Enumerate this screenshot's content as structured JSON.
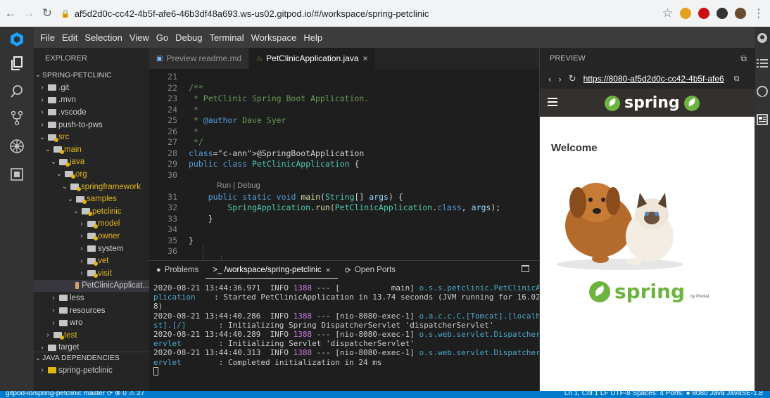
{
  "browser": {
    "url": "af5d2d0c-cc42-4b5f-afe6-46b3df48a693.ws-us02.gitpod.io/#/workspace/spring-petclinic",
    "ext_colors": [
      "#e5a11c",
      "#cc0f16",
      "#333333",
      "#6b4a2e"
    ]
  },
  "menu": [
    "File",
    "Edit",
    "Selection",
    "View",
    "Go",
    "Debug",
    "Terminal",
    "Workspace",
    "Help"
  ],
  "activity_icons": [
    "gitpod-logo-icon",
    "files-icon",
    "search-icon",
    "source-control-icon",
    "extensions-icon",
    "remote-explorer-icon"
  ],
  "right_rail_icons": [
    "github-icon",
    "outline-icon",
    "github-octocat-icon",
    "preview-icon"
  ],
  "explorer": {
    "title": "EXPLORER",
    "project": "SPRING-PETCLINIC",
    "tree": [
      {
        "label": ".git",
        "indent": 0,
        "chev": "›",
        "type": "folder"
      },
      {
        "label": ".mvn",
        "indent": 0,
        "chev": "›",
        "type": "folder"
      },
      {
        "label": ".vscode",
        "indent": 0,
        "chev": "›",
        "type": "folder"
      },
      {
        "label": "push-to-pws",
        "indent": 0,
        "chev": "›",
        "type": "folder"
      },
      {
        "label": "src",
        "indent": 0,
        "chev": "⌄",
        "type": "folder-mod"
      },
      {
        "label": "main",
        "indent": 1,
        "chev": "⌄",
        "type": "folder-mod"
      },
      {
        "label": "java",
        "indent": 2,
        "chev": "⌄",
        "type": "folder-mod"
      },
      {
        "label": "org",
        "indent": 3,
        "chev": "⌄",
        "type": "folder-mod"
      },
      {
        "label": "springframework",
        "indent": 4,
        "chev": "⌄",
        "type": "folder-mod"
      },
      {
        "label": "samples",
        "indent": 5,
        "chev": "⌄",
        "type": "folder-mod"
      },
      {
        "label": "petclinic",
        "indent": 6,
        "chev": "⌄",
        "type": "folder-mod"
      },
      {
        "label": "model",
        "indent": 7,
        "chev": "›",
        "type": "folder-mod"
      },
      {
        "label": "owner",
        "indent": 7,
        "chev": "›",
        "type": "folder-mod"
      },
      {
        "label": "system",
        "indent": 7,
        "chev": "›",
        "type": "folder"
      },
      {
        "label": "vet",
        "indent": 7,
        "chev": "›",
        "type": "folder-mod"
      },
      {
        "label": "visit",
        "indent": 7,
        "chev": "›",
        "type": "folder-mod"
      },
      {
        "label": "PetClinicApplicat...",
        "indent": 8,
        "chev": "",
        "type": "file",
        "selected": true
      },
      {
        "label": "less",
        "indent": 2,
        "chev": "›",
        "type": "folder"
      },
      {
        "label": "resources",
        "indent": 2,
        "chev": "›",
        "type": "folder"
      },
      {
        "label": "wro",
        "indent": 2,
        "chev": "›",
        "type": "folder"
      },
      {
        "label": "test",
        "indent": 1,
        "chev": "›",
        "type": "folder-mod"
      },
      {
        "label": "target",
        "indent": 0,
        "chev": "›",
        "type": "folder"
      }
    ],
    "java_deps": "JAVA DEPENDENCIES",
    "dep_item": "spring-petclinic"
  },
  "editor": {
    "tabs": [
      {
        "label": "Preview readme.md",
        "icon": "preview-icon",
        "active": false
      },
      {
        "label": "PetClinicApplication.java",
        "icon": "java-icon",
        "active": true
      }
    ],
    "code_lens": "Run | Debug",
    "lines": [
      {
        "n": "21",
        "text": ""
      },
      {
        "n": "22",
        "text": "/**"
      },
      {
        "n": "23",
        "text": " * PetClinic Spring Boot Application."
      },
      {
        "n": "24",
        "text": " *"
      },
      {
        "n": "25",
        "text": " * @author Dave Syer"
      },
      {
        "n": "26",
        "text": " *"
      },
      {
        "n": "27",
        "text": " */"
      },
      {
        "n": "28",
        "text": "@SpringBootApplication"
      },
      {
        "n": "29",
        "text": "public class PetClinicApplication {"
      },
      {
        "n": "30",
        "text": ""
      },
      {
        "n": "31",
        "text": "    public static void main(String[] args) {"
      },
      {
        "n": "32",
        "text": "        SpringApplication.run(PetClinicApplication.class, args);"
      },
      {
        "n": "33",
        "text": "    }"
      },
      {
        "n": "34",
        "text": ""
      },
      {
        "n": "35",
        "text": "}"
      },
      {
        "n": "36",
        "text": ""
      }
    ]
  },
  "panel": {
    "tabs": [
      "Problems",
      ">_ /workspace/spring-petclinic",
      "Open Ports"
    ],
    "terminal": [
      [
        [
          "2020-08-21 13:44:36.971  INFO ",
          "t-info"
        ],
        [
          "1388",
          "t-pid"
        ],
        [
          " --- [           main] ",
          "t-info"
        ],
        [
          "o.s.s.petclinic.PetClinicAp",
          "t-cls"
        ]
      ],
      [
        [
          "plication",
          "t-cls"
        ],
        [
          "    : Started PetClinicApplication in 13.74 seconds (JVM running for 16.02",
          "t-info"
        ]
      ],
      [
        [
          "8)",
          "t-info"
        ]
      ],
      [
        [
          "2020-08-21 13:44:40.286  INFO ",
          "t-info"
        ],
        [
          "1388",
          "t-pid"
        ],
        [
          " --- [nio-8080-exec-1] ",
          "t-info"
        ],
        [
          "o.a.c.c.C.[Tomcat].[localho",
          "t-cls"
        ]
      ],
      [
        [
          "st].[/]",
          "t-cls"
        ],
        [
          "       : Initializing Spring DispatcherServlet 'dispatcherServlet'",
          "t-info"
        ]
      ],
      [
        [
          "2020-08-21 13:44:40.289  INFO ",
          "t-info"
        ],
        [
          "1388",
          "t-pid"
        ],
        [
          " --- [nio-8080-exec-1] ",
          "t-info"
        ],
        [
          "o.s.web.servlet.DispatcherS",
          "t-cls"
        ]
      ],
      [
        [
          "ervlet",
          "t-cls"
        ],
        [
          "        : Initializing Servlet 'dispatcherServlet'",
          "t-info"
        ]
      ],
      [
        [
          "2020-08-21 13:44:40.313  INFO ",
          "t-info"
        ],
        [
          "1388",
          "t-pid"
        ],
        [
          " --- [nio-8080-exec-1] ",
          "t-info"
        ],
        [
          "o.s.web.servlet.DispatcherS",
          "t-cls"
        ]
      ],
      [
        [
          "ervlet",
          "t-cls"
        ],
        [
          "        : Completed initialization in 24 ms",
          "t-info"
        ]
      ]
    ]
  },
  "preview": {
    "title": "PREVIEW",
    "url": "https://8080-af5d2d0c-cc42-4b5f-afe6-...",
    "brand": "spring",
    "welcome": "Welcome",
    "footer_brand": "spring",
    "footer_by": "by Pivotal."
  },
  "status": {
    "left": "gitpod-io/spring-petclinic   master   ⟳   ⊗ 0 ⚠ 27",
    "right": "Ln 1, Col 1   LF   UTF-8   Spaces: 4   Ports: ● 8080   Java   JavaSE-1.8"
  }
}
